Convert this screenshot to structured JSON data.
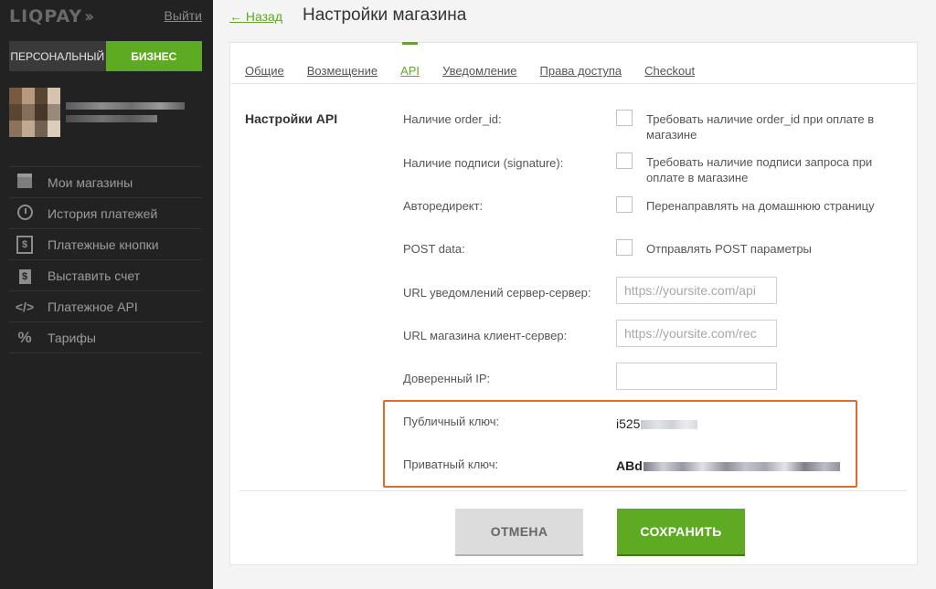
{
  "sidebar": {
    "logo": "LIQPAY",
    "logout": "Выйти",
    "account": {
      "personal": "ПЕРСОНАЛЬНЫЙ",
      "business": "БИЗНЕС"
    },
    "nav": [
      {
        "label": "Мои магазины",
        "icon": "store-icon"
      },
      {
        "label": "История платежей",
        "icon": "history-icon"
      },
      {
        "label": "Платежные кнопки",
        "icon": "dollar-icon"
      },
      {
        "label": "Выставить счет",
        "icon": "invoice-icon"
      },
      {
        "label": "Платежное API",
        "icon": "code-icon"
      },
      {
        "label": "Тарифы",
        "icon": "percent-icon"
      }
    ]
  },
  "header": {
    "back": "← Назад",
    "title": "Настройки магазина"
  },
  "tabs": [
    "Общие",
    "Возмещение",
    "API",
    "Уведомление",
    "Права доступа",
    "Checkout"
  ],
  "active_tab": "API",
  "api": {
    "section_title": "Настройки API",
    "order_id": {
      "label": "Наличие order_id:",
      "text": "Требовать наличие order_id при оплате в магазине"
    },
    "signature": {
      "label": "Наличие подписи (signature):",
      "text": "Требовать наличие подписи запроса при оплате в магазине"
    },
    "autoredirect": {
      "label": "Авторедирект:",
      "text": "Перенаправлять на домашнюю страницу"
    },
    "post_data": {
      "label": "POST data:",
      "text": "Отправлять POST параметры"
    },
    "server_url": {
      "label": "URL уведомлений сервер-сервер:",
      "placeholder": "https://yoursite.com/api"
    },
    "result_url": {
      "label": "URL магазина клиент-сервер:",
      "placeholder": "https://yoursite.com/rec"
    },
    "trusted_ip": {
      "label": "Доверенный IP:",
      "value": ""
    },
    "public_key": {
      "label": "Публичный ключ:",
      "value": "i525"
    },
    "private_key": {
      "label": "Приватный ключ:",
      "value": "ABd"
    }
  },
  "buttons": {
    "cancel": "ОТМЕНА",
    "save": "СОХРАНИТЬ"
  },
  "colors": {
    "accent": "#5eaa22",
    "highlight": "#e06b2d",
    "sidebar": "#222222"
  }
}
